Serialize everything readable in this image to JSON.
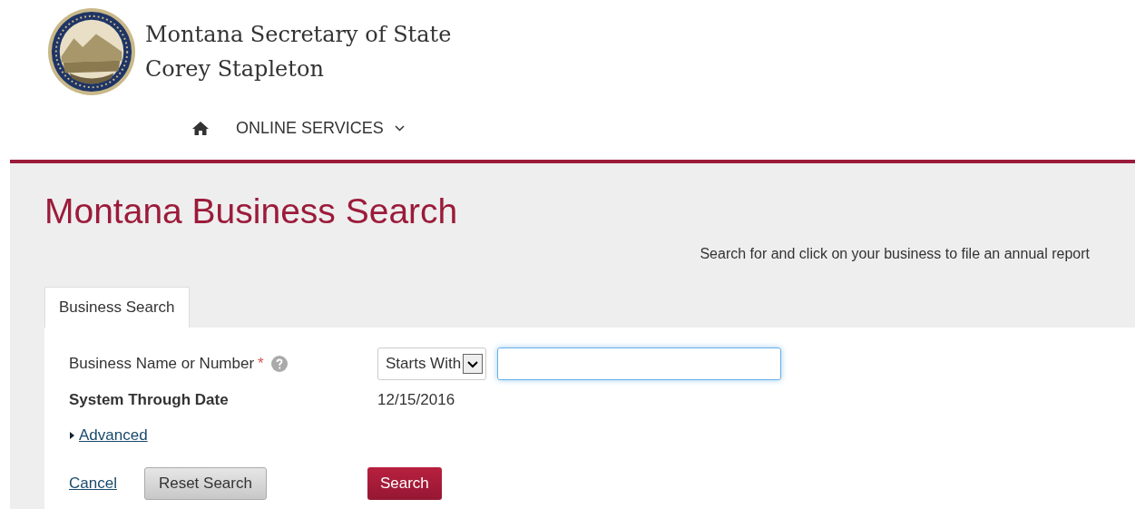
{
  "header": {
    "title": "Montana Secretary of State",
    "subtitle": "Corey Stapleton"
  },
  "nav": {
    "items": [
      {
        "kind": "home"
      },
      {
        "kind": "menu",
        "label": "ONLINE SERVICES"
      }
    ]
  },
  "page": {
    "title": "Montana Business Search",
    "hint": "Search for and click on your business to file an annual report"
  },
  "tabs": [
    {
      "label": "Business Search",
      "selected": true
    }
  ],
  "form": {
    "name_label": "Business Name or Number",
    "required_mark": "*",
    "match": "Starts With",
    "date_label": "System Through Date",
    "date_value": "12/15/2016",
    "advanced": "Advanced",
    "advanced_expanded": false
  },
  "buttons": {
    "cancel": "Cancel",
    "reset": "Reset Search",
    "search": "Search"
  }
}
